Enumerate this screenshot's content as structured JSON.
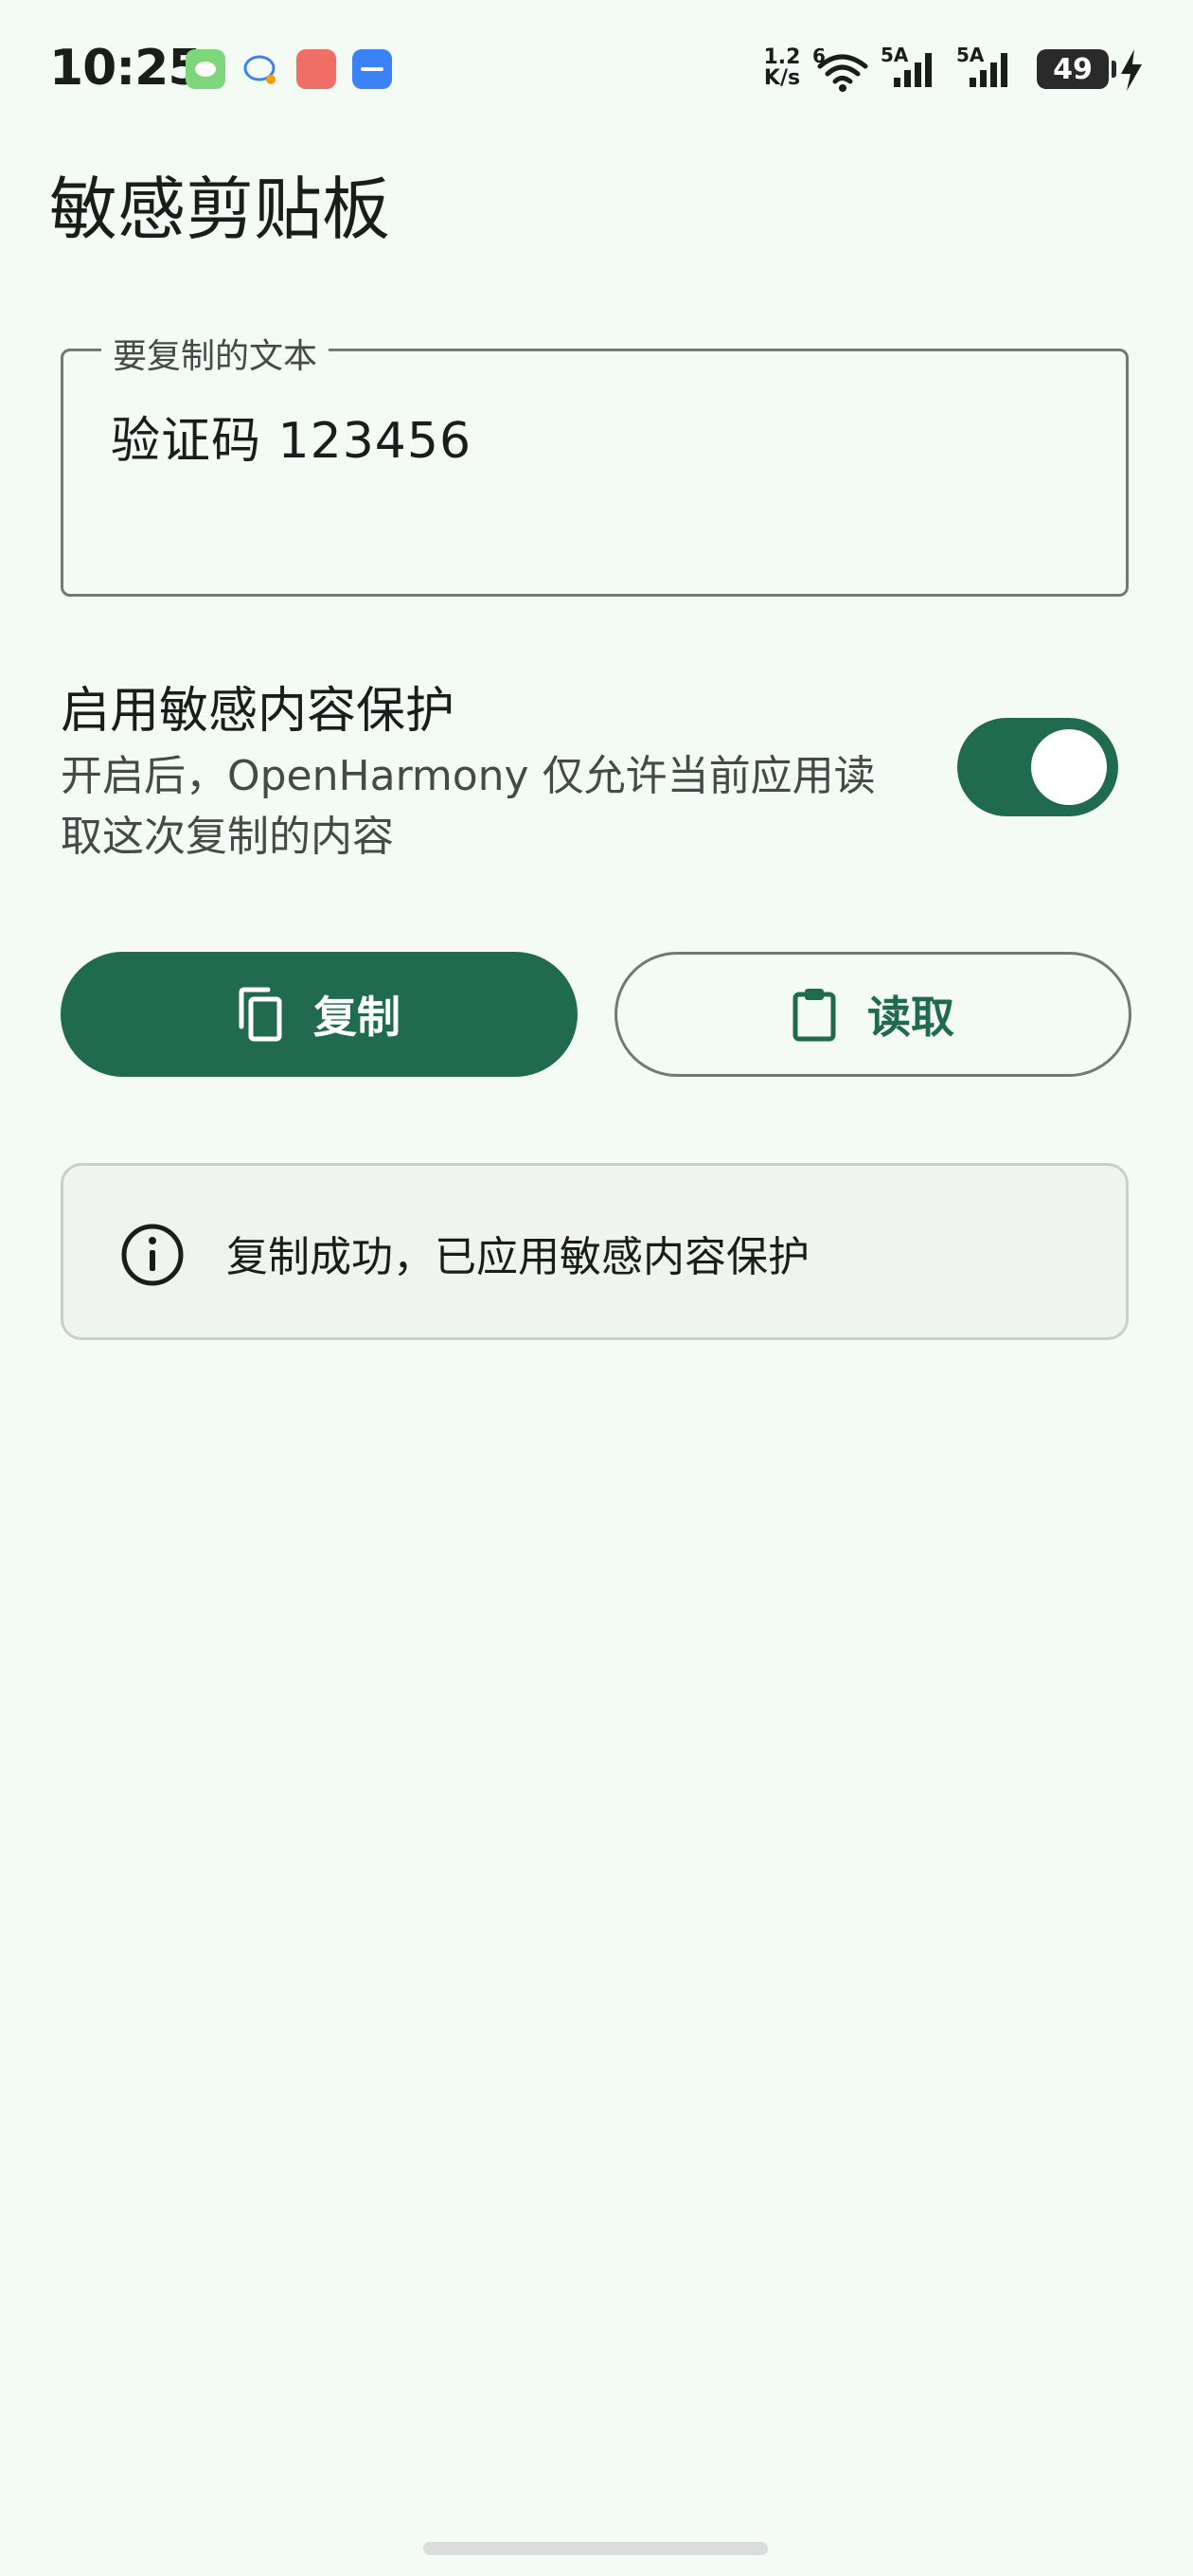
{
  "status_bar": {
    "time": "10:25",
    "net_speed_value": "1.2",
    "net_speed_unit": "K/s",
    "wifi_label": "6",
    "signal_1_label": "5A",
    "signal_2_label": "5A",
    "battery": "49",
    "notification_icons": [
      "wechat-icon",
      "chat-bubble-icon",
      "xiaohongshu-icon",
      "usb-icon"
    ]
  },
  "app": {
    "title": "敏感剪贴板"
  },
  "text_field": {
    "label": "要复制的文本",
    "value": "验证码 123456"
  },
  "sensitive_toggle": {
    "title": "启用敏感内容保护",
    "description": "开启后，OpenHarmony 仅允许当前应用读取这次复制的内容",
    "checked": true
  },
  "buttons": {
    "copy_label": "复制",
    "read_label": "读取"
  },
  "info": {
    "message": "复制成功，已应用敏感内容保护"
  },
  "colors": {
    "primary": "#206a50",
    "background": "#f4faf4",
    "outline": "#6f7a72",
    "card_bg": "#f0f4ef"
  }
}
